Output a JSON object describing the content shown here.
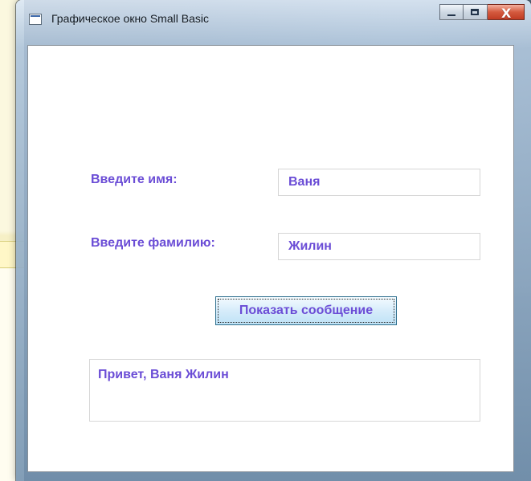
{
  "window": {
    "title": "Графическое окно Small Basic",
    "icon": "small-basic-app-icon",
    "caption_buttons": [
      {
        "name": "minimize",
        "icon": "minimize-icon"
      },
      {
        "name": "maximize",
        "icon": "maximize-icon"
      },
      {
        "name": "close",
        "icon": "close-icon"
      }
    ]
  },
  "form": {
    "first_name_label": "Введите имя:",
    "first_name_value": "Ваня",
    "last_name_label": "Введите фамилию:",
    "last_name_value": "Жилин",
    "show_button_label": "Показать сообщение",
    "output_text": "Привет, Ваня Жилин"
  },
  "colors": {
    "text_purple": "#6b4dd6"
  }
}
